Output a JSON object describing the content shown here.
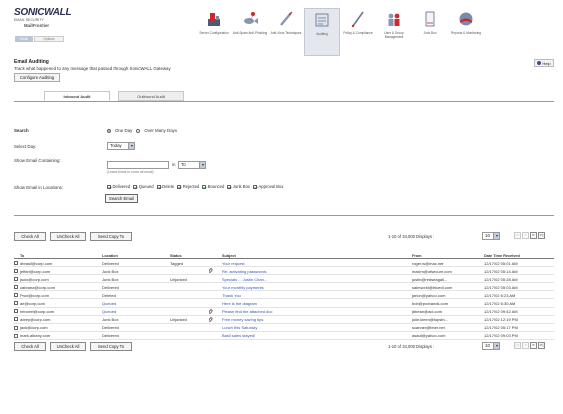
{
  "logo": {
    "brand": "SONICWALL",
    "tagline": "EMAIL SECURITY",
    "product": "MailFrontier",
    "tabs": [
      "Email",
      "Options"
    ]
  },
  "nav": [
    {
      "label": "Server Configuration",
      "icon": "server-icon"
    },
    {
      "label": "Anti-Spam Anti-Phishing",
      "icon": "fish-icon"
    },
    {
      "label": "Anti-Virus Techniques",
      "icon": "syringe-icon"
    },
    {
      "label": "Auditing",
      "icon": "auditing-icon",
      "selected": true
    },
    {
      "label": "Policy & Compliance",
      "icon": "policy-pen-icon"
    },
    {
      "label": "User & Group Management",
      "icon": "users-icon"
    },
    {
      "label": "Junk Box",
      "icon": "junk-box-icon"
    },
    {
      "label": "Reports & Monitoring",
      "icon": "reports-globe-icon"
    }
  ],
  "section": {
    "title": "Email Auditing",
    "description": "Track what happened to any message that passed through SonicWALL Gateway",
    "configure_label": "Configure Auditing",
    "help_label": "Help"
  },
  "audit_tabs": [
    "Inbound Audit",
    "Outbound Audit"
  ],
  "search": {
    "heading": "Search",
    "range_options": [
      "One Day",
      "Over Many Days"
    ],
    "select_day_label": "Select Day:",
    "select_day_value": "Today",
    "contain_label": "Show Email Containing:",
    "in_word": "in",
    "field_value": "To",
    "contain_hint": "(Leave blank to show all email)",
    "location_label": "Show Email in Locations:",
    "locations": [
      "Delivered",
      "Queued",
      "Delete",
      "Rejected",
      "Bounced",
      "Junk Box",
      "Approval Box"
    ],
    "button_label": "Search Email"
  },
  "toolbar": {
    "check_all": "Check All",
    "uncheck_all": "UnCheck All",
    "send_copy": "Send Copy To",
    "page_info": "1-10 of 34,000 Displays :",
    "page_size": "10",
    "pager": [
      "|<",
      "<",
      ">",
      ">|"
    ]
  },
  "table": {
    "columns": [
      "To",
      "Location",
      "Status",
      "Subject",
      "From",
      "Date Time Received"
    ],
    "rows": [
      {
        "to": "dbrasil@corp.com",
        "location": "Delivered",
        "status": "Tagged",
        "attach": false,
        "subject": "Your request",
        "from": "roger.w@mac.net",
        "date": "12/17/02 05:01 AM"
      },
      {
        "to": "jeffarl@corp.com",
        "location": "Junk Box",
        "status": "",
        "attach": true,
        "subject": "Re: activating passwords",
        "from": "maxim@ofsecure.com",
        "date": "12/17/02 05:14 AM"
      },
      {
        "to": "jsolo@corp.com",
        "location": "Junk Box",
        "status": "Unjunked",
        "attach": false,
        "subject": "Specials ... Justin Chan...",
        "from": "justin@redseagall...",
        "date": "12/17/02 05:28 AM"
      },
      {
        "to": "cabrana@corp.com",
        "location": "Delivered",
        "status": "",
        "attach": false,
        "subject": "Your monthly payments",
        "from": "saleworld@bluedi.com",
        "date": "12/17/02 05:03 AM"
      },
      {
        "to": "Prod@corp.com",
        "location": "Deleted",
        "status": "",
        "attach": false,
        "subject": "Thank You",
        "from": "jarlon@yahoo.com",
        "date": "12/17/02 6:23 AM"
      },
      {
        "to": "ae@corp.com",
        "location": "Queued",
        "status": "",
        "attach": false,
        "subject": "Here is the diagram",
        "from": "bob@probands.com",
        "date": "12/17/02 6:30 AM"
      },
      {
        "to": "mtronet@corp.com",
        "location": "Queued",
        "status": "",
        "attach": true,
        "subject": "Please find the attached doc",
        "from": "jbbean@aol.com",
        "date": "12/17/02 09:42 AM"
      },
      {
        "to": "adrey@corp.com",
        "location": "Junk Box",
        "status": "Unjunked",
        "attach": true,
        "subject": "Free money saving tips",
        "from": "jolie.kleen@topsth...",
        "date": "12/17/02 12:19 PM"
      },
      {
        "to": "jack@corp.com",
        "location": "Delivered",
        "status": "",
        "attach": false,
        "subject": "Lunch this Saturday",
        "from": "scanner@bher.net",
        "date": "12/17/02 05:17 PM"
      },
      {
        "to": "mark.albany.com",
        "location": "Delivered",
        "status": "",
        "attach": false,
        "subject": "Basil sales stayed!",
        "from": "asaut@yahoo.com",
        "date": "12/17/02 09:03 PM"
      }
    ]
  },
  "colors": {
    "link": "#3355aa",
    "queued_link": "#3355aa",
    "selected_nav": "#e4e8ee"
  }
}
